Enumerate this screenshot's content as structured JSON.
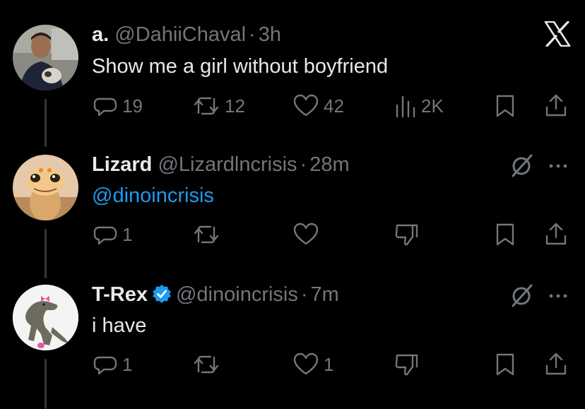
{
  "tweets": [
    {
      "name": "a.",
      "handle": "@DahiiChaval",
      "time": "3h",
      "text": "Show me a girl without boyfriend",
      "replies": "19",
      "retweets": "12",
      "likes": "42",
      "views": "2K"
    },
    {
      "name": "Lizard",
      "handle": "@Lizardlncrisis",
      "time": "28m",
      "text": "@dinoincrisis",
      "replies": "1",
      "retweets": "",
      "likes": ""
    },
    {
      "name": "T-Rex",
      "handle": "@dinoincrisis",
      "time": "7m",
      "text": "i have",
      "replies": "1",
      "retweets": "",
      "likes": "1"
    }
  ],
  "separator": "·",
  "colors": {
    "background": "#000000",
    "text": "#e7e9ea",
    "muted": "#71767b",
    "accent": "#1d9bf0",
    "thread_line": "#333639"
  },
  "icons": [
    "x-logo-icon",
    "reply-icon",
    "retweet-icon",
    "like-icon",
    "views-icon",
    "dislike-icon",
    "bookmark-icon",
    "share-icon",
    "more-icon",
    "grok-icon",
    "verified-badge-icon"
  ]
}
